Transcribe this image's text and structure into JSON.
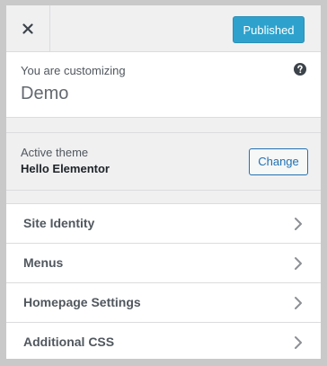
{
  "header": {
    "close_label": "Close",
    "publish_label": "Published",
    "accent_color": "#2ea2cc"
  },
  "info": {
    "customizing_label": "You are customizing",
    "site_name": "Demo",
    "help_icon": "help-icon"
  },
  "theme": {
    "label": "Active theme",
    "name": "Hello Elementor",
    "change_label": "Change"
  },
  "menu": {
    "items": [
      {
        "label": "Site Identity"
      },
      {
        "label": "Menus"
      },
      {
        "label": "Homepage Settings"
      },
      {
        "label": "Additional CSS"
      }
    ]
  }
}
